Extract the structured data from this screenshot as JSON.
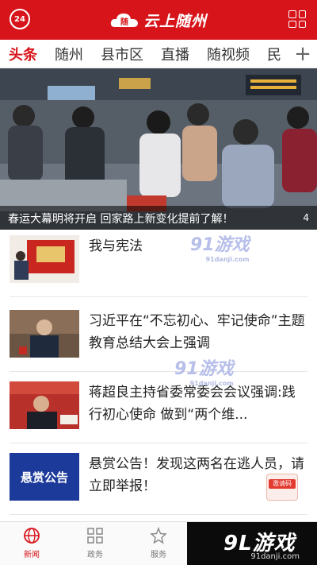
{
  "header": {
    "left_badge": "24",
    "logo_title": "云上随州",
    "logo_mark": "随"
  },
  "tabs": [
    {
      "label": "头条",
      "active": true
    },
    {
      "label": "随州",
      "active": false
    },
    {
      "label": "县市区",
      "active": false
    },
    {
      "label": "直播",
      "active": false
    },
    {
      "label": "随视频",
      "active": false
    },
    {
      "label": "民",
      "active": false
    }
  ],
  "tabs_more": "+",
  "hero": {
    "caption": "春运大幕明将开启 回家路上新变化提前了解！",
    "pager": "4"
  },
  "articles": [
    {
      "title": "我与宪法"
    },
    {
      "title": "习近平在“不忘初心、牢记使命”主题教育总结大会上强调"
    },
    {
      "title": "蒋超良主持省委常委会会议强调:践行初心使命 做到“两个维..."
    },
    {
      "title": "悬赏公告！发现这两名在逃人员，请立即举报！",
      "thumb_text": "悬赏公告"
    }
  ],
  "watermarks": [
    {
      "brand": "91游戏",
      "domain": "91danji.com"
    },
    {
      "brand": "91游戏",
      "domain": "91danji.com"
    }
  ],
  "float_envelope": {
    "label": "邀请码"
  },
  "bottom_nav": [
    {
      "label": "新闻",
      "icon": "globe-icon",
      "active": true
    },
    {
      "label": "政务",
      "icon": "grid-icon",
      "active": false
    },
    {
      "label": "服务",
      "icon": "star-icon",
      "active": false
    }
  ],
  "banner": {
    "brand": "9L游戏",
    "domain": "91danji.com"
  },
  "colors": {
    "brand_red": "#d7141a",
    "tab_text": "#333333",
    "nav_inactive": "#777777"
  }
}
